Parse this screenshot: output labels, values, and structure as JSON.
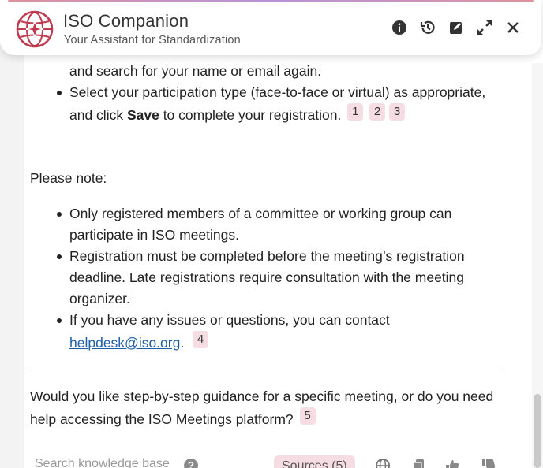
{
  "header": {
    "title": "ISO Companion",
    "subtitle": "Your Assistant for Standardization",
    "buttons": [
      "info-icon",
      "history-icon",
      "edit-icon",
      "expand-icon",
      "close-icon"
    ]
  },
  "message": {
    "partial_line": "and search for your name or email again.",
    "bullet_select": {
      "text_before": "Select your participation type (face-to-face or virtual) as appropriate, and click ",
      "bold": "Save",
      "text_after": " to complete your registration.",
      "refs": [
        "1",
        "2",
        "3"
      ]
    },
    "note_heading": "Please note:",
    "notes": [
      {
        "text": "Only registered members of a committee or working group can participate in ISO meetings."
      },
      {
        "text": "Registration must be completed before the meeting’s registration deadline. Late registrations require consultation with the meeting organizer."
      },
      {
        "text": "If you have any issues or questions, you can contact ",
        "link": "helpdesk@iso.org",
        "after": ".",
        "ref": "4"
      }
    ],
    "question": "Would you like step-by-step guidance for a specific meeting, or do you need help accessing the ISO Meetings platform?",
    "question_ref": "5"
  },
  "footer": {
    "search_placeholder": "Search knowledge base",
    "help_icon": "?",
    "sources_label": "Sources (5)",
    "icons": [
      "globe-icon",
      "copy-icon",
      "thumbs-up-icon",
      "thumbs-down-icon"
    ]
  },
  "colors": {
    "accent": "#c0394d",
    "ref_badge": "#f6dce3",
    "link": "#1f5fa8"
  }
}
